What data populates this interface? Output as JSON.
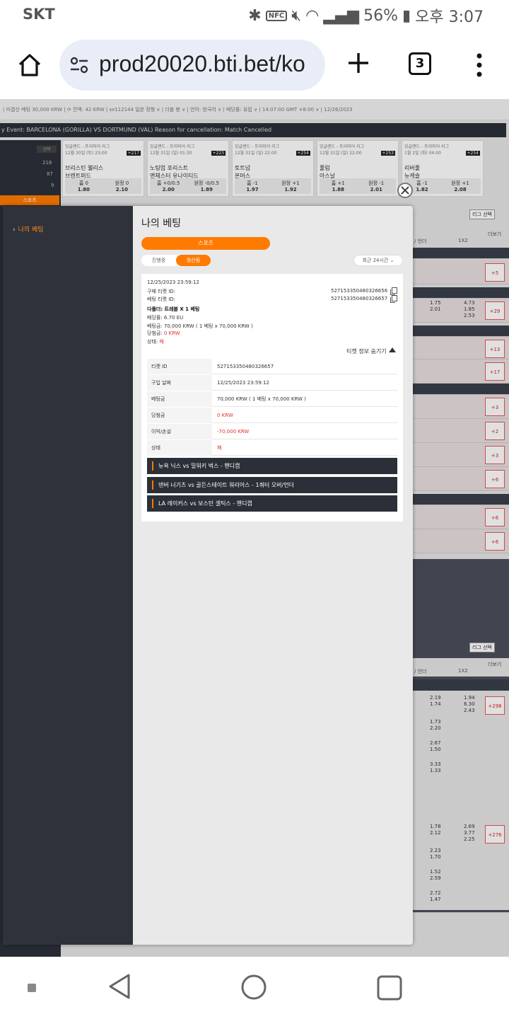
{
  "status_bar": {
    "carrier": "SKT",
    "nfc": "NFC",
    "battery": "56%",
    "time": "오후 3:07"
  },
  "browser": {
    "url": "prod20020.bti.bet/ko",
    "tab_count": "3"
  },
  "background_page": {
    "topline": "| 미결산 베팅 30,000 KRW | ⟳ 잔액: 42 KRW | sx112144                                                                          일본 정형 ∨ | 더블 봉 ∨ | 언어: 한국어 ∨ | 배당률: 유럽 ∨ | 14:07:00 GMT +8:00 ∨ | 12/26/2023",
    "ticker": "y Event: BARCELONA (GORILLA) VS DORTMUND (VAL) Reason for cancellation: Match Cancelled",
    "counts": [
      "218",
      "87",
      "9"
    ],
    "sport_button": "스포츠",
    "cards": [
      {
        "league": "잉글랜드 - 프리미어 리그",
        "date": "12월 30일 (토) 23:00",
        "badge": "+217",
        "home": "브리스틴 웰리스",
        "away": "브렌트퍼드",
        "h_label": "홈 0",
        "a_label": "원정 0",
        "h_odd": "1.80",
        "a_odd": "2.10"
      },
      {
        "league": "잉글랜드 - 프리미어 리그",
        "date": "12월 31일 (일) 01:30",
        "badge": "+223",
        "home": "노팅엄 포리스트",
        "away": "맨체스터 유나이티드",
        "h_label": "홈 +0/0.5",
        "a_label": "원정 -0/0.5",
        "h_odd": "2.00",
        "a_odd": "1.89"
      },
      {
        "league": "잉글랜드 - 프리미어 리그",
        "date": "12월 31일 (일) 22:00",
        "badge": "+254",
        "home": "토트넘",
        "away": "본머스",
        "h_label": "홈 -1",
        "a_label": "원정 +1",
        "h_odd": "1.97",
        "a_odd": "1.92"
      },
      {
        "league": "잉글랜드 - 프리미어 리그",
        "date": "12월 31일 (일) 22:00",
        "badge": "+253",
        "home": "풀럼",
        "away": "아스날",
        "h_label": "홈 +1",
        "a_label": "원정 -1",
        "h_odd": "1.88",
        "a_odd": "2.01"
      },
      {
        "league": "잉글랜드 - 프리미어 리그",
        "date": "1월 2일 (화) 04:00",
        "badge": "+254",
        "home": "리버풀",
        "away": "뉴캐슬",
        "h_label": "홈 -1",
        "a_label": "원정 +1",
        "h_odd": "1.82",
        "a_odd": "2.08"
      }
    ],
    "right_labels": {
      "league_select": "리그 선택",
      "more": "더보기",
      "over_under": "/ 언더",
      "onextwo": "1X2"
    },
    "plus_counts": [
      "+5",
      "+29",
      "+13",
      "+17",
      "+3",
      "+2",
      "+3",
      "+6",
      "+6",
      "+6",
      "+298",
      "+276"
    ],
    "odds_blocks": [
      [
        "1.75\n2.01",
        "4.73\n1.85\n2.53"
      ],
      [
        "2.19\n1.74",
        "1.94\n6.30\n2.43"
      ],
      [
        "1.73\n2.20",
        ""
      ],
      [
        "2.67\n1.50",
        ""
      ],
      [
        "3.33\n1.33",
        ""
      ],
      [
        "1.78\n2.12",
        "2.69\n3.77\n2.25"
      ],
      [
        "2.23\n1.70",
        ""
      ],
      [
        "1.52\n2.59",
        ""
      ],
      [
        "2.72\n1.47",
        ""
      ]
    ]
  },
  "modal": {
    "sidebar_item": "나의 베팅",
    "title": "나의 베팅",
    "sport_tab": "스포츠",
    "segment": {
      "open": "진행중",
      "settled": "정산됨"
    },
    "period": "최근 24시간",
    "ticket": {
      "datetime": "12/25/2023 23:59:12",
      "purchase_ticket_label": "구매 티켓 ID:",
      "purchase_ticket_id": "527153350480326656",
      "bet_ticket_label": "베팅 티켓 ID:",
      "bet_ticket_id": "527153350480326657",
      "bet_type": "다폴더: 트레블 X 1 베팅",
      "odds": "배당률: 6.70 EU",
      "stake": "베팅금: 70,000 KRW ( 1 베팅 x 70,000 KRW )",
      "payout_label": "당첨금:",
      "payout": "0 KRW",
      "status_label": "상태:",
      "status": "패",
      "hide_info": "티켓 정보 숨기기"
    },
    "details": [
      {
        "key": "티켓 ID",
        "value": "527153350480326657",
        "red": false
      },
      {
        "key": "구입 날짜",
        "value": "12/25/2023 23:59:12",
        "red": false
      },
      {
        "key": "베팅금",
        "value": "70,000 KRW ( 1 베팅 x 70,000 KRW )",
        "red": false
      },
      {
        "key": "당첨금",
        "value": "0 KRW",
        "red": true
      },
      {
        "key": "이익/손실",
        "value": "-70,000 KRW",
        "red": true
      },
      {
        "key": "상태",
        "value": "패",
        "red": true
      }
    ],
    "legs": [
      "뉴욕 닉스 vs 밀워키 벅스 - 핸디캡",
      "덴버 너기츠 vs 골든스테이트 워리어스 - 1쿼터 오버/언더",
      "LA 레이커스 vs 보스턴 셀틱스 - 핸디캡"
    ]
  }
}
